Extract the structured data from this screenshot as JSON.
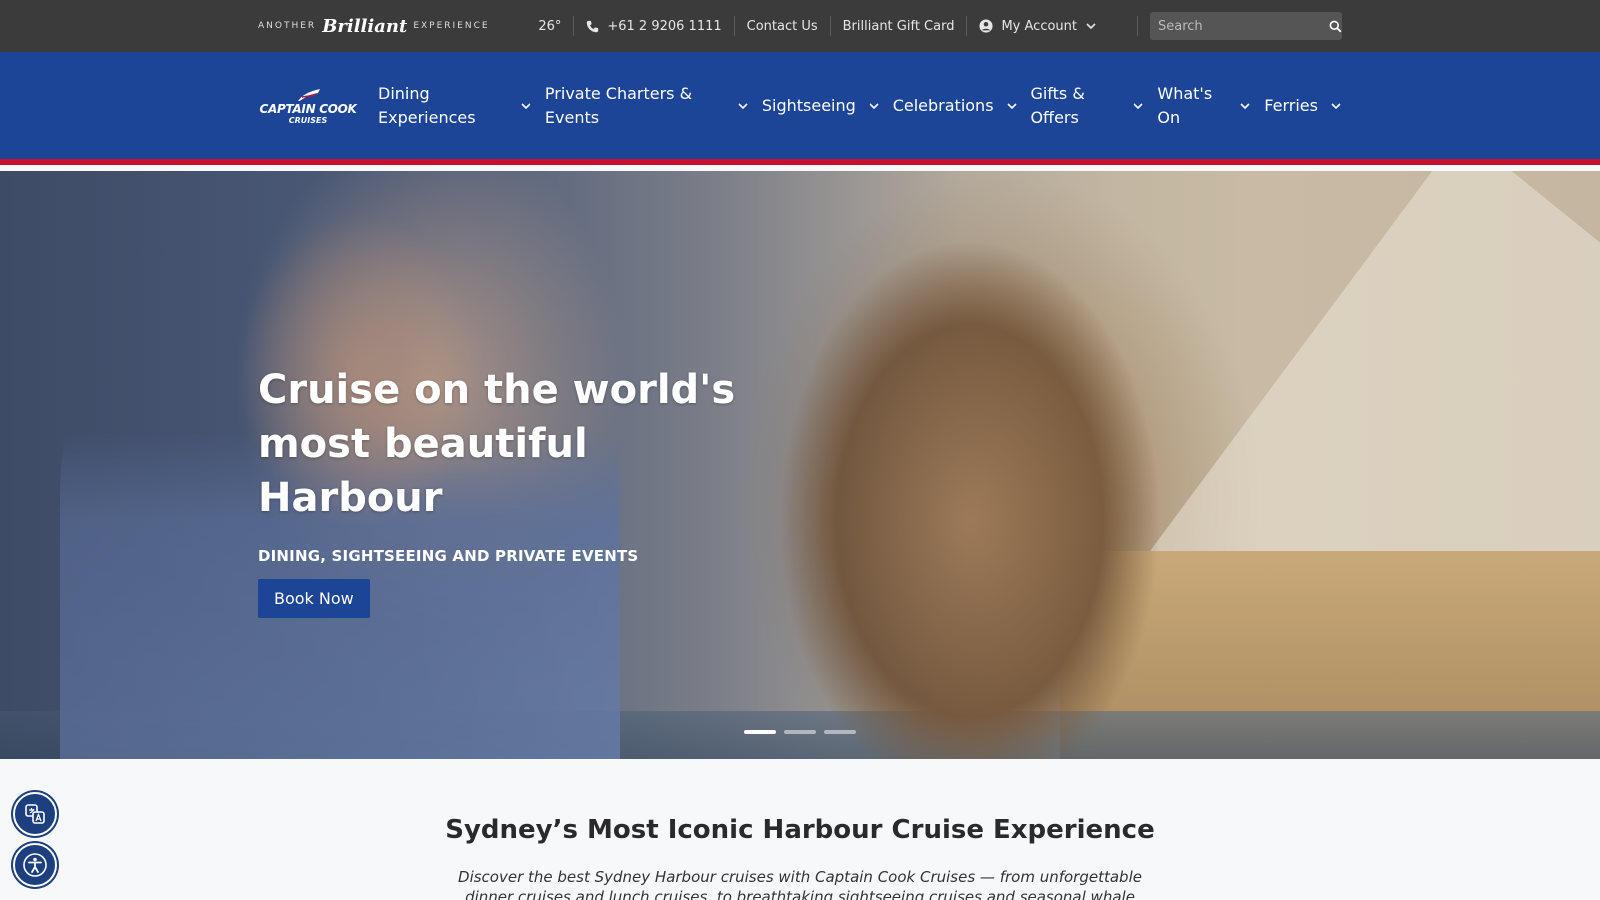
{
  "topbar": {
    "tagline_pre": "Another",
    "tagline_script": "Brilliant",
    "tagline_post": "Experience",
    "temperature": "26°",
    "phone": "+61 2 9206 1111",
    "contact": "Contact Us",
    "gift_card": "Brilliant Gift Card",
    "account": "My Account",
    "search_placeholder": "Search"
  },
  "nav": {
    "logo_line1": "CAPTAIN COOK",
    "logo_line2": "CRUISES",
    "items": [
      {
        "label": "Dining Experiences"
      },
      {
        "label": "Private Charters & Events"
      },
      {
        "label": "Sightseeing"
      },
      {
        "label": "Celebrations"
      },
      {
        "label": "Gifts & Offers"
      },
      {
        "label": "What's On"
      },
      {
        "label": "Ferries"
      }
    ]
  },
  "hero": {
    "title": "Cruise on the world's most beautiful Harbour",
    "subtitle": "DINING, SIGHTSEEING AND PRIVATE EVENTS",
    "cta": "Book Now",
    "slides": 3,
    "active_slide": 1
  },
  "intro": {
    "heading": "Sydney’s Most Iconic Harbour Cruise Experience",
    "text": "Discover the best Sydney Harbour cruises with Captain Cook Cruises — from unforgettable dinner cruises and lunch cruises, to breathtaking sightseeing cruises and seasonal whale watching."
  },
  "colors": {
    "topbar": "#3b3b3b",
    "nav": "#1c4598",
    "nav_accent": "#c8102e",
    "button": "#1c4598"
  },
  "icons": {
    "phone": "phone-icon",
    "account": "user-circle-icon",
    "chevron": "chevron-down-icon",
    "search": "search-icon",
    "translate": "translate-icon",
    "accessibility": "accessibility-icon"
  }
}
